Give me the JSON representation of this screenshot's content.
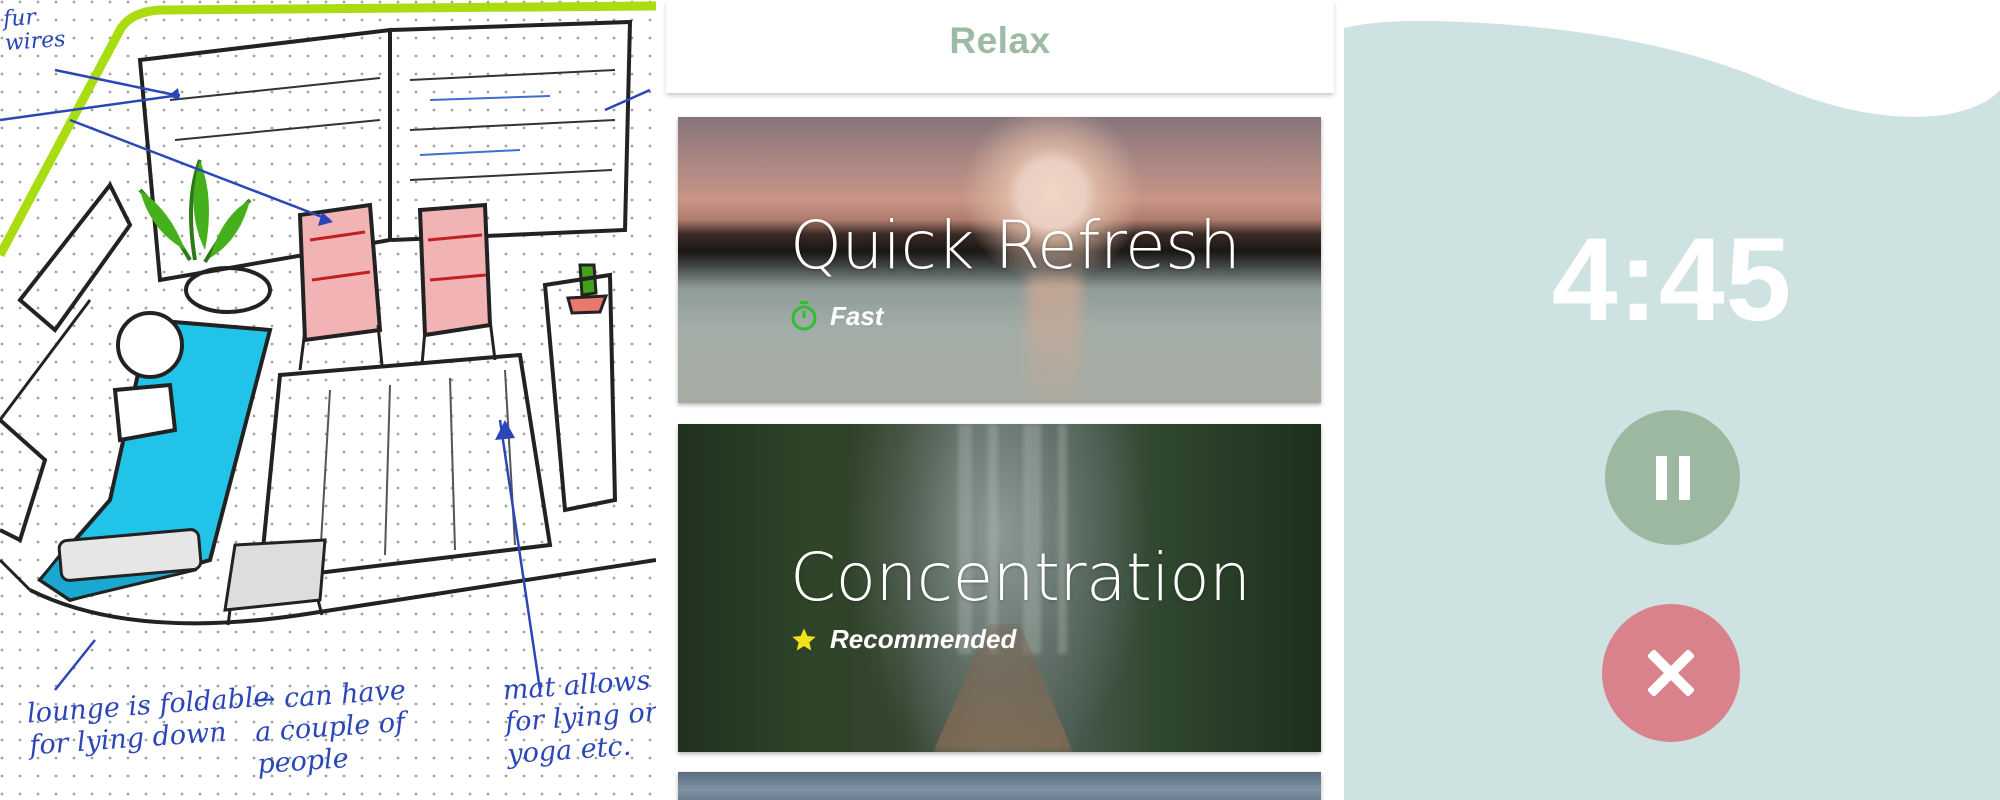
{
  "sketch": {
    "notes": [
      "fur\nwires",
      "lounge is foldable\nfor lying down",
      "→ can have\na couple of\npeople",
      "mat allows\nfor lying or\nyoga etc."
    ]
  },
  "relax": {
    "title": "Relax",
    "cards": [
      {
        "title": "Quick Refresh",
        "tag": "Fast",
        "tag_icon": "stopwatch-icon",
        "tag_color": "#2fbf2f"
      },
      {
        "title": "Concentration",
        "tag": "Recommended",
        "tag_icon": "star-icon",
        "tag_color": "#f2e21a"
      },
      {
        "title": "",
        "tag": ""
      }
    ]
  },
  "timer": {
    "time": "4:45",
    "pause_icon": "pause-icon",
    "cancel_icon": "close-icon",
    "colors": {
      "background": "#cfe2e2",
      "pause": "#9db8a1",
      "cancel": "#d9828b"
    }
  }
}
